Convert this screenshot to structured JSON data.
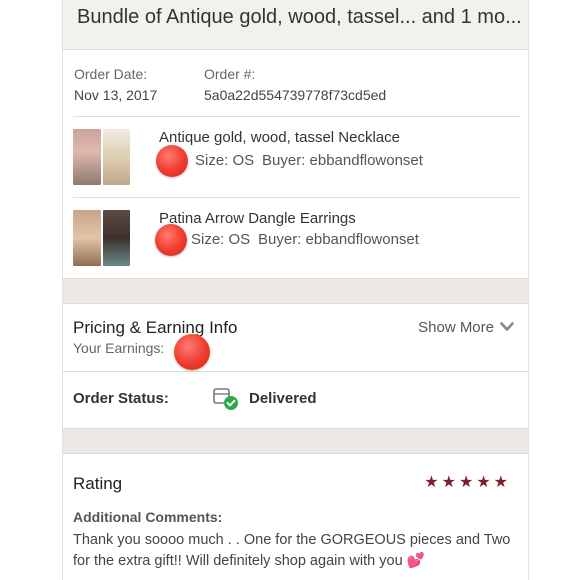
{
  "header": {
    "title": "Bundle of Antique gold, wood, tassel... and 1 mo..."
  },
  "order": {
    "date_label": "Order Date:",
    "date_value": "Nov 13, 2017",
    "number_label": "Order #:",
    "number_value": "5a0a22d554739778f73cd5ed"
  },
  "items": [
    {
      "name": "Antique gold, wood, tassel Necklace",
      "size_label": "Size: OS",
      "buyer_label": "Buyer: ebbandflowonset",
      "thumb_colors": [
        "#d9a9a0",
        "#e8ddd0"
      ]
    },
    {
      "name": "Patina Arrow Dangle Earrings",
      "size_label": "Size: OS",
      "buyer_label": "Buyer: ebbandflowonset",
      "thumb_colors": [
        "#b9977c",
        "#4a3c35"
      ]
    }
  ],
  "pricing": {
    "title": "Pricing & Earning Info",
    "earnings_label": "Your Earnings:",
    "show_more": "Show More"
  },
  "status": {
    "label": "Order Status:",
    "value": "Delivered",
    "icon": "delivered-box-check-icon"
  },
  "rating": {
    "title": "Rating",
    "stars": 5,
    "comments_label": "Additional Comments:",
    "comment": "Thank you soooo much . . One for the GORGEOUS pieces and Two for the extra gift!! Will definitely shop again with you",
    "comment_emoji": "💕"
  },
  "colors": {
    "star": "#7a1f2b",
    "redact_dot": "#f03a2f",
    "band": "#ece9e4"
  }
}
